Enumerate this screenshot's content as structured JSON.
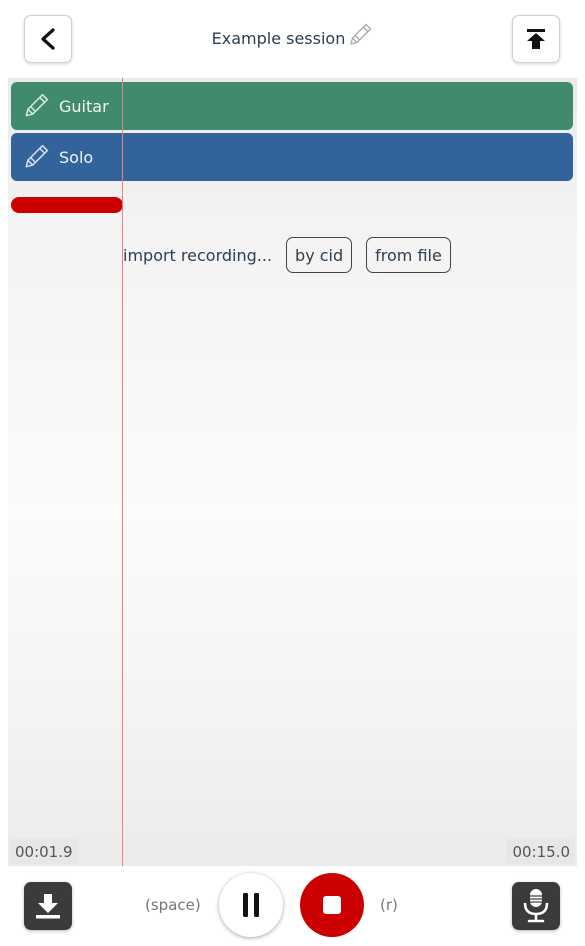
{
  "header": {
    "title": "Example session",
    "back_icon": "chevron-left-icon",
    "top_icon": "arrow-to-top-icon"
  },
  "tracks": [
    {
      "label": "Guitar",
      "color": "#408b6d",
      "icon": "pencil-icon"
    },
    {
      "label": "Solo",
      "color": "#32639a",
      "icon": "pencil-icon"
    }
  ],
  "recording": {
    "color": "#cc0000"
  },
  "import": {
    "label": "import recording...",
    "by_cid": "by cid",
    "from_file": "from file"
  },
  "timeline": {
    "current_time": "00:01.9",
    "total_time": "00:15.0",
    "playhead_color": "#f08080"
  },
  "footer": {
    "space_hint": "(space)",
    "r_hint": "(r)",
    "download_icon": "download-icon",
    "pause_icon": "pause-icon",
    "stop_icon": "stop-icon",
    "mic_icon": "microphone-icon"
  }
}
